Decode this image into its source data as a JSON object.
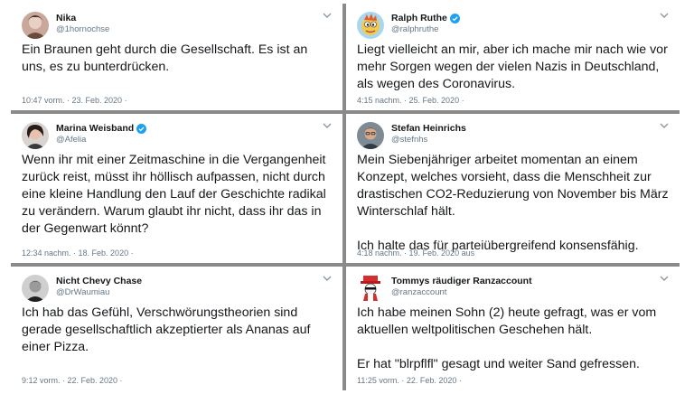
{
  "tweets": [
    {
      "name": "Nika",
      "handle": "@1hornochse",
      "verified": false,
      "avatar_icon": "profile-photo-icon",
      "text": [
        "Ein Braunen geht durch die Gesellschaft. Es ist an uns, es zu bunterdrücken."
      ],
      "meta": "10:47 vorm. · 23. Feb. 2020 ·"
    },
    {
      "name": "Ralph Ruthe",
      "handle": "@ralphruthe",
      "verified": true,
      "avatar_icon": "cartoon-avatar-icon",
      "text": [
        "Liegt vielleicht an mir, aber ich mache mir nach wie vor mehr Sorgen wegen der vielen Nazis in Deutschland, als wegen des Coronavirus."
      ],
      "meta": "4:15 nachm. · 25. Feb. 2020 ·"
    },
    {
      "name": "Marina Weisband",
      "handle": "@Afelia",
      "verified": true,
      "avatar_icon": "profile-photo-icon",
      "text": [
        "Wenn ihr mit einer Zeitmaschine in die Vergangenheit zurück reist, müsst ihr höllisch aufpassen, nicht durch eine kleine Handlung den Lauf der Geschichte radikal zu verändern. Warum glaubt ihr nicht, dass ihr das in der Gegenwart könnt?"
      ],
      "meta": "12:34 nachm. · 18. Feb. 2020 ·"
    },
    {
      "name": "Stefan Heinrichs",
      "handle": "@stefnhs",
      "verified": false,
      "avatar_icon": "profile-photo-icon",
      "text": [
        "Mein Siebenjähriger arbeitet momentan an einem Konzept, welches vorsieht, dass die Menschheit zur drastischen CO2-Reduzierung von November bis März Winterschlaf hält.",
        "Ich halte das für parteiübergreifend konsensfähig."
      ],
      "meta": "4:18 nachm. · 19. Feb. 2020 aus"
    },
    {
      "name": "Nicht Chevy Chase",
      "handle": "@DrWaumiau",
      "verified": false,
      "avatar_icon": "profile-photo-icon",
      "text": [
        "Ich hab das Gefühl, Verschwörungstheorien sind gerade gesellschaftlich akzeptierter als Ananas auf einer Pizza."
      ],
      "meta": "9:12 vorm. · 22. Feb. 2020 ·"
    },
    {
      "name": "Tommys räudiger Ranzaccount",
      "handle": "@ranzaccount",
      "verified": false,
      "avatar_icon": "masked-character-avatar-icon",
      "text": [
        "Ich habe meinen Sohn (2) heute gefragt, was er vom aktuellen weltpolitischen Geschehen hält.",
        "Er hat \"blrpflfl\" gesagt und weiter Sand gefressen."
      ],
      "meta": "11:25 vorm. · 22. Feb. 2020 ·"
    }
  ],
  "colors": {
    "verified_blue": "#1da1f2",
    "muted_text": "#657786",
    "divider": "#8a8a8a"
  }
}
